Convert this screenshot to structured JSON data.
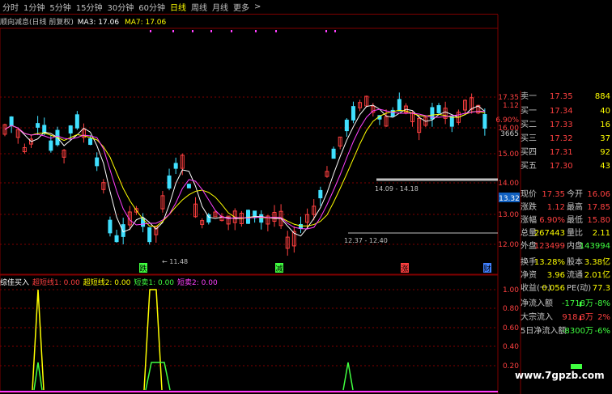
{
  "toolbar": {
    "periods": [
      "分时",
      "1分钟",
      "5分钟",
      "15分钟",
      "30分钟",
      "60分钟",
      "日线",
      "周线",
      "月线",
      "更多"
    ],
    "active": "日线",
    "more_arrow": ">"
  },
  "kline_info": {
    "title": "顺向减息(日线 前复权)",
    "ma3": "MA3: 17.06",
    "ma7": "MA7: 17.06"
  },
  "price_axis": {
    "labels": [
      "17.35",
      "16.00",
      "15.00",
      "14.00",
      "13.00",
      "12.00"
    ],
    "current_label": "13.32",
    "change_labels": [
      "1.12",
      "6.90%",
      "3665"
    ]
  },
  "annotations": {
    "low_label": "11.48",
    "range1": "14.09 - 14.18",
    "range2": "12.37 - 12.40",
    "marker_labels": [
      "跌",
      "减",
      "涨",
      "财"
    ]
  },
  "indicator": {
    "legend": [
      {
        "text": "综佳买入",
        "color": "#ffffff"
      },
      {
        "text": "超短线1: 0.00",
        "color": "#ff4040"
      },
      {
        "text": "超短线2: 0.00",
        "color": "#ffff00"
      },
      {
        "text": "短卖1: 0.00",
        "color": "#40ff40"
      },
      {
        "text": "短卖2: 0.00",
        "color": "#ff40ff"
      }
    ],
    "axis_labels": [
      "1.00",
      "0.80",
      "0.60",
      "0.40",
      "0.20"
    ]
  },
  "quote": {
    "sell": [
      {
        "label": "卖一",
        "price": "17.35",
        "vol": "884"
      }
    ],
    "buy": [
      {
        "label": "买一",
        "price": "17.34",
        "vol": "40"
      },
      {
        "label": "买二",
        "price": "17.33",
        "vol": "16"
      },
      {
        "label": "买三",
        "price": "17.32",
        "vol": "37"
      },
      {
        "label": "买四",
        "price": "17.31",
        "vol": "92"
      },
      {
        "label": "买五",
        "price": "17.30",
        "vol": "43"
      }
    ],
    "stats": [
      {
        "l1": "现价",
        "v1": "17.35",
        "l2": "今开",
        "v2": "16.06",
        "c1": "#ff4040",
        "c2": "#ff4040"
      },
      {
        "l1": "涨跌",
        "v1": "1.12",
        "l2": "最高",
        "v2": "17.85",
        "c1": "#ff4040",
        "c2": "#ff4040"
      },
      {
        "l1": "涨幅",
        "v1": "6.90%",
        "l2": "最低",
        "v2": "15.80",
        "c1": "#ff4040",
        "c2": "#ff4040"
      },
      {
        "l1": "总量",
        "v1": "267443",
        "l2": "量比",
        "v2": "2.11",
        "c1": "#ffff00",
        "c2": "#ffff00"
      },
      {
        "l1": "外盘",
        "v1": "123499",
        "l2": "内盘",
        "v2": "143994",
        "c1": "#ff4040",
        "c2": "#40ff40"
      },
      {
        "l1": "换手",
        "v1": "13.28%",
        "l2": "股本",
        "v2": "3.38亿",
        "c1": "#ffff00",
        "c2": "#ffff00"
      },
      {
        "l1": "净资",
        "v1": "3.96",
        "l2": "流通",
        "v2": "2.01亿",
        "c1": "#ffff00",
        "c2": "#ffff00"
      },
      {
        "l1": "收益(一)",
        "v1": "0.056",
        "l2": "PE(动)",
        "v2": "77.3",
        "c1": "#ffff00",
        "c2": "#ffff00"
      }
    ],
    "flows": [
      {
        "label": "净流入额",
        "value": "-1718万",
        "pct": "-8%",
        "color": "#40ff40"
      },
      {
        "label": "大宗流入",
        "value": "918.3万",
        "pct": "2%",
        "color": "#ff4040"
      },
      {
        "label": "5日净流入额",
        "value": "-8300万",
        "pct": "-6%",
        "color": "#40ff40"
      }
    ]
  },
  "colors": {
    "up": "#ff4040",
    "down": "#40e0ff",
    "ma3": "#ffffff",
    "ma7": "#ffff00",
    "ma_other": "#ff40ff",
    "grid": "#800000"
  },
  "watermark": "www.7gpzb.com"
}
